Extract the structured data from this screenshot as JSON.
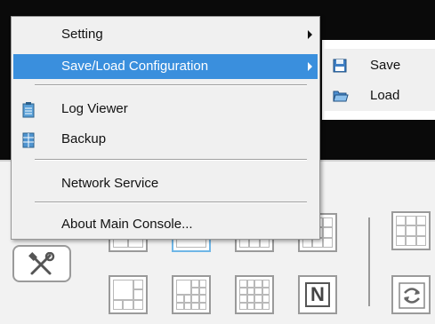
{
  "context_menu": {
    "items": [
      {
        "label": "Setting",
        "has_submenu": true
      },
      {
        "label": "Save/Load Configuration",
        "has_submenu": true,
        "highlighted": true
      },
      {
        "label": "Log Viewer",
        "icon": "log-viewer-icon"
      },
      {
        "label": "Backup",
        "icon": "backup-icon"
      },
      {
        "label": "Network Service"
      },
      {
        "label": "About Main Console..."
      }
    ]
  },
  "submenu": {
    "items": [
      {
        "label": "Save",
        "icon": "floppy-disk-icon"
      },
      {
        "label": "Load",
        "icon": "open-folder-icon"
      }
    ]
  },
  "toolbar": {
    "tools_icon": "tools-icon",
    "layout_icons": [
      "layout-4-icon",
      "layout-single-selected-icon",
      "layout-6-icon",
      "layout-8-icon",
      "layout-9-icon",
      "layout-7-icon",
      "layout-10-icon",
      "layout-13-icon",
      "layout-16-icon",
      "layout-n-icon",
      "sequence-icon"
    ],
    "n_label": "N"
  },
  "colors": {
    "highlight": "#3a8fdd",
    "menu_bg": "#f0f0f0",
    "selected_layout_border": "#6fb6e6"
  }
}
